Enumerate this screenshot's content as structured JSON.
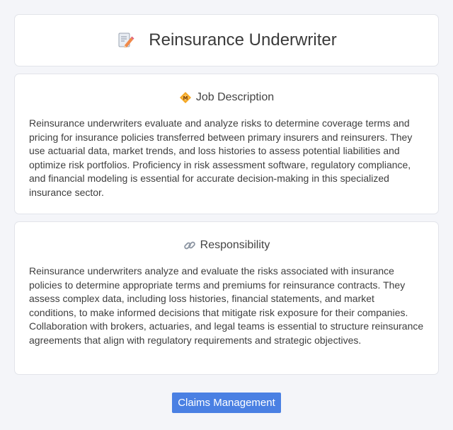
{
  "header": {
    "title": "Reinsurance Underwriter",
    "icon": "document-pencil-icon"
  },
  "job_description": {
    "heading": "Job Description",
    "icon": "diamond-badge-icon",
    "body": "Reinsurance underwriters evaluate and analyze risks to determine coverage terms and pricing for insurance policies transferred between primary insurers and reinsurers. They use actuarial data, market trends, and loss histories to assess potential liabilities and optimize risk portfolios. Proficiency in risk assessment software, regulatory compliance, and financial modeling is essential for accurate decision-making in this specialized insurance sector."
  },
  "responsibility": {
    "heading": "Responsibility",
    "icon": "link-icon",
    "body": "Reinsurance underwriters analyze and evaluate the risks associated with insurance policies to determine appropriate terms and premiums for reinsurance contracts. They assess complex data, including loss histories, financial statements, and market conditions, to make informed decisions that mitigate risk exposure for their companies. Collaboration with brokers, actuaries, and legal teams is essential to structure reinsurance agreements that align with regulatory requirements and strategic objectives."
  },
  "tag": {
    "label": "Claims Management"
  },
  "colors": {
    "background": "#f4f5f9",
    "tag_bg": "#4a80e3"
  }
}
